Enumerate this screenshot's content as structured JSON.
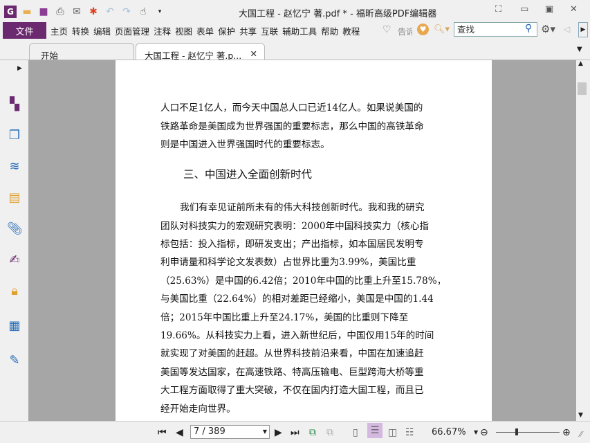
{
  "window": {
    "title": "大国工程 - 赵忆宁 著.pdf * - 福昕高级PDF编辑器"
  },
  "menu": {
    "file": "文件",
    "items": [
      "主页",
      "转换",
      "编辑",
      "页面管理",
      "注释",
      "视图",
      "表单",
      "保护",
      "共享",
      "互联",
      "辅助工具",
      "帮助",
      "教程"
    ],
    "tell_me": "告诉",
    "search_placeholder": "查找"
  },
  "tabs": [
    {
      "label": "开始"
    },
    {
      "label": "大国工程 - 赵忆宁 著.p...",
      "close": "✕"
    }
  ],
  "document": {
    "lines": [
      "人口不足1亿人，而今天中国总人口已近14亿人。如果说美国的",
      "铁路革命是美国成为世界强国的重要标志，那么中国的高铁革命",
      "则是中国进入世界强国时代的重要标志。"
    ],
    "heading": "三、中国进入全面创新时代",
    "para": [
      "我们有幸见证前所未有的伟大科技创新时代。我和我的研究",
      "团队对科技实力的宏观研究表明：2000年中国科技实力（核心指",
      "标包括：投入指标，即研发支出；产出指标，如本国居民发明专",
      "利申请量和科学论文发表数）占世界比重为3.99%，美国比重",
      "（25.63%）是中国的6.42倍；2010年中国的比重上升至15.78%，",
      "与美国比重（22.64%）的相对差距已经缩小，美国是中国的1.44",
      "倍；2015年中国比重上升至24.17%，美国的比重则下降至",
      "19.66%。从科技实力上看，进入新世纪后，中国仅用15年的时间",
      "就实现了对美国的赶超。从世界科技前沿来看，中国在加速追赶",
      "美国等发达国家，在高速铁路、特高压输电、巨型跨海大桥等重",
      "大工程方面取得了重大突破，不仅在国内打造大国工程，而且已",
      "经开始走向世界。"
    ]
  },
  "status": {
    "page": "7 / 389",
    "zoom": "66.67%",
    "zoom_slider": 0.33
  },
  "colors": {
    "brand": "#6b2a6f"
  }
}
